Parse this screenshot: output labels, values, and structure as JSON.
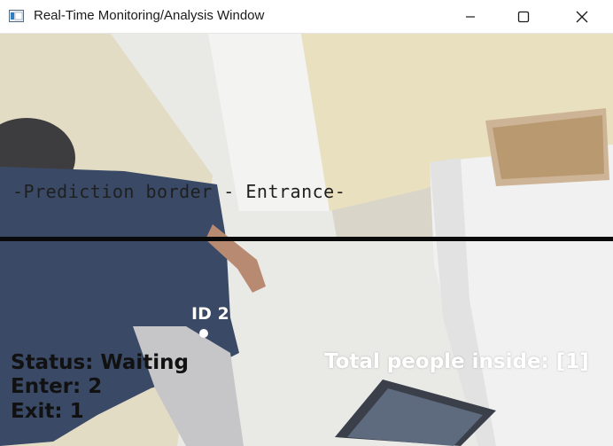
{
  "window": {
    "title": "Real-Time Monitoring/Analysis Window",
    "icons": {
      "app": "app-window-icon",
      "minimize": "minimize-icon",
      "maximize": "maximize-icon",
      "close": "close-icon"
    }
  },
  "video": {
    "prediction_border_label": "-Prediction border - Entrance-",
    "tracked_person_label": "ID 2",
    "status_text": "Status: Waiting",
    "enter_text": "Enter: 2",
    "exit_text": "Exit: 1",
    "total_inside_text": "Total people inside: [1]",
    "colors": {
      "border_line": "#0a0a0a",
      "hud_dark": "#111111",
      "hud_light": "#ffffff"
    }
  }
}
